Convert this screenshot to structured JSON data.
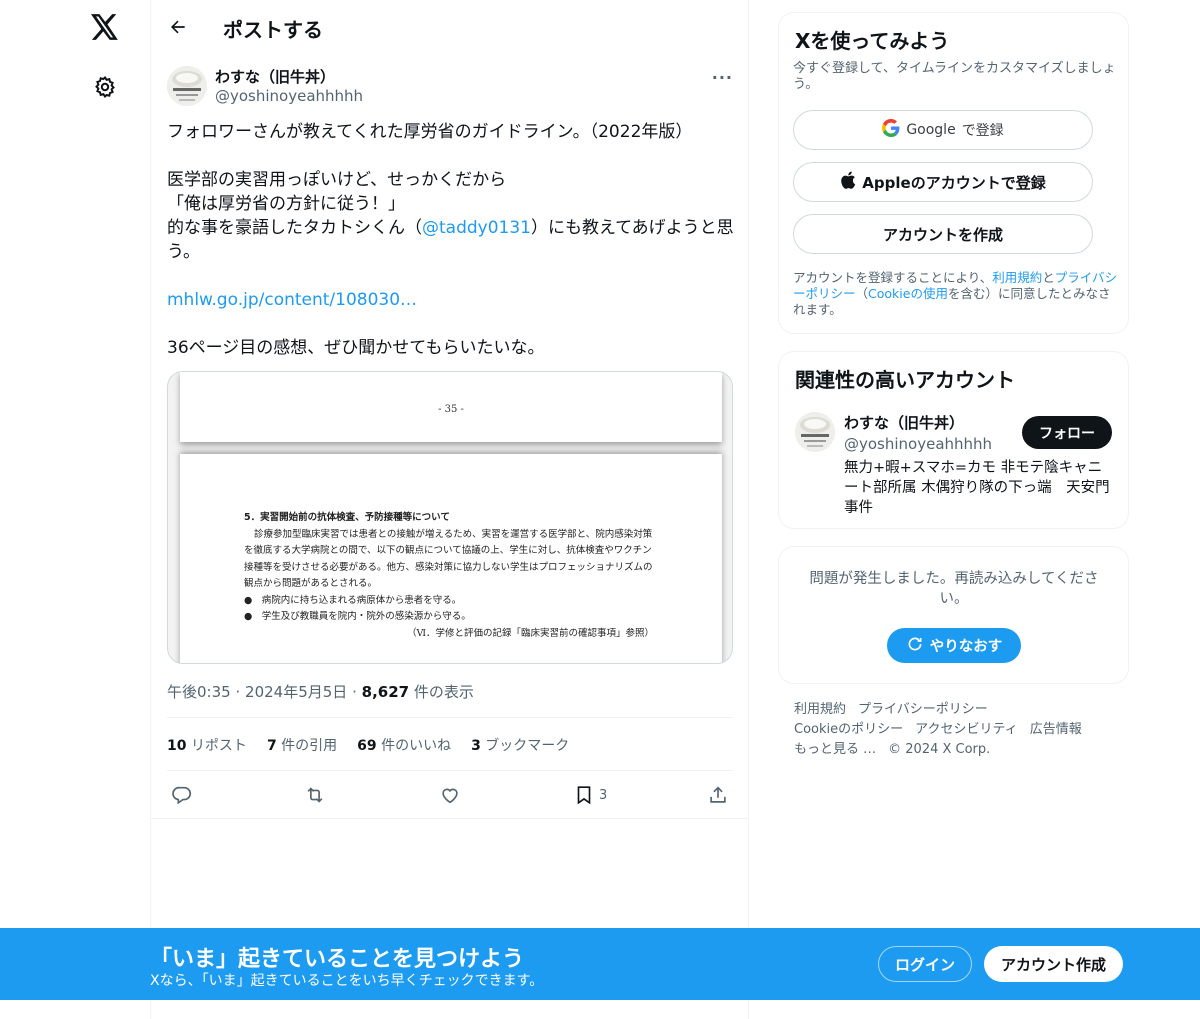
{
  "header": {
    "title": "ポストする"
  },
  "tweet": {
    "display_name": "わすな（旧牛丼）",
    "handle": "@yoshinoyeahhhhh",
    "more": "···",
    "line1": "フォロワーさんが教えてくれた厚労省のガイドライン。（2022年版）",
    "line2": "医学部の実習用っぽいけど、せっかくだから",
    "line3": "「俺は厚労省の方針に従う！」",
    "line4a": "的な事を豪語したタカトシくん（",
    "mention": "@taddy0131",
    "line4b": "）にも教えてあげようと思う。",
    "url": "mhlw.go.jp/content/108030…",
    "line5": "36ページ目の感想、ぜひ聞かせてもらいたいな。",
    "time": "午後0:35",
    "date": "2024年5月5日",
    "views_count": "8,627",
    "views_label": "件の表示",
    "sep": "·"
  },
  "media": {
    "page_number": "- 35 -",
    "heading": "5．実習開始前の抗体検査、予防接種等について",
    "para1": "診療参加型臨床実習では患者との接触が増えるため、実習を運営する医学部と、院内感染対策",
    "para2": "を徹底する大学病院との間で、以下の観点について協議の上、学生に対し、抗体検査やワクチン",
    "para3": "接種等を受けさせる必要がある。他方、感染対策に協力しない学生はプロフェッショナリズムの",
    "para4": "観点から問題があるとされる。",
    "bullet1": "●　病院内に持ち込まれる病原体から患者を守る。",
    "bullet2": "●　学生及び教職員を院内・院外の感染源から守る。",
    "ref": "（Ⅵ．学修と評価の記録「臨床実習前の確認事項」参照）"
  },
  "stats": {
    "reposts_count": "10",
    "reposts_label": "リポスト",
    "quotes_count": "7",
    "quotes_label": "件の引用",
    "likes_count": "69",
    "likes_label": "件のいいね",
    "bookmarks_count": "3",
    "bookmarks_label": "ブックマーク"
  },
  "actions": {
    "bookmark_count": "3"
  },
  "signup_card": {
    "title": "Xを使ってみよう",
    "subtitle": "今すぐ登録して、タイムラインをカスタマイズしましょう。",
    "google_brand": "Google",
    "google_label": "で登録",
    "apple_label": "Appleのアカウントで登録",
    "create_label": "アカウントを作成",
    "terms_1": "アカウントを登録することにより、",
    "terms_tos": "利用規約",
    "terms_2": "と",
    "terms_privacy": "プライバシーポリシー",
    "terms_3": "（",
    "terms_cookie": "Cookieの使用",
    "terms_4": "を含む）に同意したとみなされます。"
  },
  "related_card": {
    "title": "関連性の高いアカウント",
    "name": "わすな（旧牛丼）",
    "handle": "@yoshinoyeahhhhh",
    "bio": "無力+暇+スマホ=カモ 非モテ陰キャニート部所属 木偶狩り隊の下っ端　天安門事件",
    "follow_label": "フォロー"
  },
  "error_card": {
    "message": "問題が発生しました。再読み込みしてください。",
    "retry_label": "やりなおす"
  },
  "footer": {
    "tos": "利用規約",
    "privacy": "プライバシーポリシー",
    "cookie": "Cookieのポリシー",
    "accessibility": "アクセシビリティ",
    "ads": "広告情報",
    "more": "もっと見る …",
    "copyright": "© 2024 X Corp."
  },
  "banner": {
    "title": "「いま」起きていることを見つけよう",
    "subtitle": "Xなら、「いま」起きていることをいち早くチェックできます。",
    "login_label": "ログイン",
    "signup_label": "アカウント作成"
  },
  "colors": {
    "accent": "#1d9bf0",
    "text": "#0f1419",
    "muted": "#536471",
    "border": "#eff3f4"
  }
}
